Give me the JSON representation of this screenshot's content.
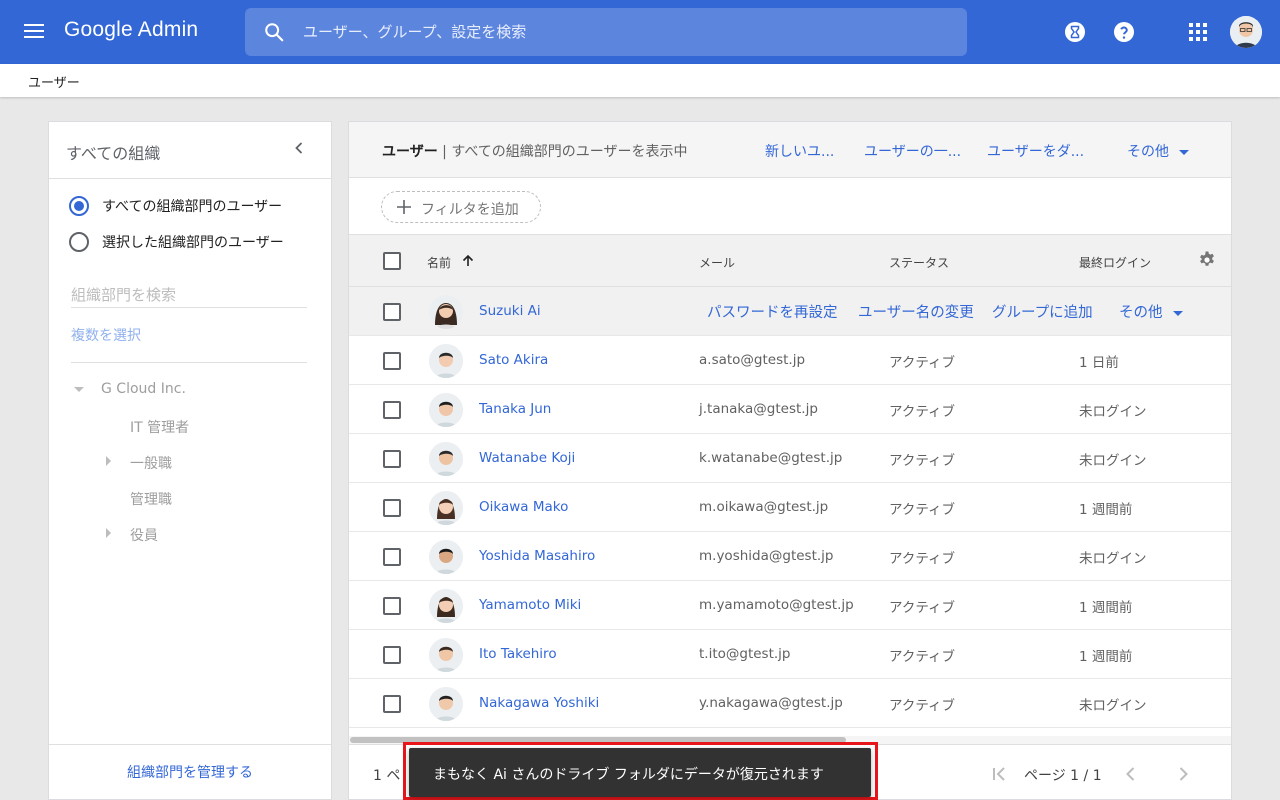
{
  "topbar": {
    "brand": "Google Admin",
    "search_placeholder": "ユーザー、グループ、設定を検索",
    "accent_color": "#3367d6",
    "icons": [
      "menu-icon",
      "search-icon",
      "hourglass-icon",
      "help-icon",
      "apps-icon",
      "account-avatar"
    ]
  },
  "breadcrumb": "ユーザー",
  "sidebar": {
    "title": "すべての組織",
    "radio_all": "すべての組織部門のユーザー",
    "radio_selected": "選択した組織部門のユーザー",
    "selected_radio": "all",
    "org_search_placeholder": "組織部門を検索",
    "multi_select": "複数を選択",
    "tree": {
      "root": "G Cloud Inc.",
      "children": [
        "IT 管理者",
        "一般職",
        "管理職",
        "役員"
      ]
    },
    "manage_link": "組織部門を管理する"
  },
  "main": {
    "title_bold": "ユーザー",
    "title_rest": " | すべての組織部門のユーザーを表示中",
    "actions": [
      "新しいユ...",
      "ユーザーの一...",
      "ユーザーをダ...",
      "その他"
    ],
    "filter_label": "フィルタを追加",
    "columns": [
      "名前",
      "メール",
      "ステータス",
      "最終ログイン"
    ],
    "sort_column": "名前",
    "hover_row": {
      "name": "Suzuki Ai",
      "actions": [
        "パスワードを再設定",
        "ユーザー名の変更",
        "グループに追加",
        "その他"
      ]
    },
    "users": [
      {
        "name": "Sato Akira",
        "email": "a.sato@gtest.jp",
        "status": "アクティブ",
        "last_login": "1 日前"
      },
      {
        "name": "Tanaka Jun",
        "email": "j.tanaka@gtest.jp",
        "status": "アクティブ",
        "last_login": "未ログイン"
      },
      {
        "name": "Watanabe Koji",
        "email": "k.watanabe@gtest.jp",
        "status": "アクティブ",
        "last_login": "未ログイン"
      },
      {
        "name": "Oikawa Mako",
        "email": "m.oikawa@gtest.jp",
        "status": "アクティブ",
        "last_login": "1 週間前"
      },
      {
        "name": "Yoshida Masahiro",
        "email": "m.yoshida@gtest.jp",
        "status": "アクティブ",
        "last_login": "未ログイン"
      },
      {
        "name": "Yamamoto Miki",
        "email": "m.yamamoto@gtest.jp",
        "status": "アクティブ",
        "last_login": "1 週間前"
      },
      {
        "name": "Ito Takehiro",
        "email": "t.ito@gtest.jp",
        "status": "アクティブ",
        "last_login": "1 週間前"
      },
      {
        "name": "Nakagawa Yoshiki",
        "email": "y.nakagawa@gtest.jp",
        "status": "アクティブ",
        "last_login": "未ログイン"
      }
    ],
    "footer": {
      "row_count": "1 ペ",
      "page_label": "ページ 1 / 1"
    }
  },
  "snackbar": {
    "text": "まもなく Ai さんのドライブ フォルダにデータが復元されます",
    "highlight_color": "#e8161b"
  }
}
